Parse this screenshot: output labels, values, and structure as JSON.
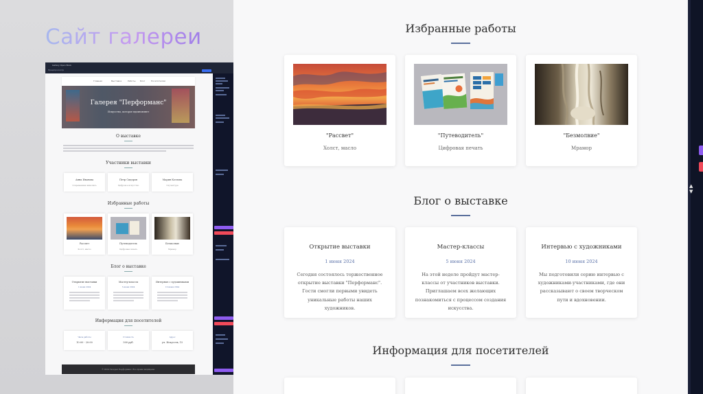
{
  "slide": {
    "title": "Сайт галереи"
  },
  "preview": {
    "window_title": "Gallery Open Book",
    "toolbar_label": "Предпросмотр",
    "nav_items": [
      "Главная",
      "Выставка",
      "Работы",
      "Блог",
      "Посетителям"
    ],
    "hero_title": "Галерея \"Перформанс\"",
    "hero_subtitle": "Искусство, которое вдохновляет",
    "about_title": "О выставке",
    "participants_title": "Участники выставки",
    "participants": [
      {
        "name": "Анна Иванова",
        "role": "Современная живопись"
      },
      {
        "name": "Петр Сидоров",
        "role": "Цифровое искусство"
      },
      {
        "name": "Мария Козлова",
        "role": "Скульптура"
      }
    ],
    "works_title": "Избранные работы",
    "works": [
      {
        "title": "Рассвет",
        "sub": "Холст, масло"
      },
      {
        "title": "Путеводитель",
        "sub": "Цифровая печать"
      },
      {
        "title": "Безмолвие",
        "sub": "Мрамор"
      }
    ],
    "blog_title": "Блог о выставке",
    "blog": [
      {
        "title": "Открытие выставки",
        "date": "1 июня 2024"
      },
      {
        "title": "Мастер-классы",
        "date": "5 июня 2024"
      },
      {
        "title": "Интервью с художниками",
        "date": "10 июня 2024"
      }
    ],
    "info_title": "Информация для посетителей",
    "info": [
      {
        "label": "Часы работы",
        "value": "10:00 - 20:00"
      },
      {
        "label": "Стоимость",
        "value": "500 руб."
      },
      {
        "label": "Адрес",
        "value": "ул. Искусств, 15"
      }
    ],
    "footer": "© 2024 Галерея Перформанс. Все права защищены."
  },
  "main": {
    "works_section": {
      "title": "Избранные работы",
      "cards": [
        {
          "title": "\"Рассвет\"",
          "subtitle": "Холст, масло",
          "image": "sunset-painting"
        },
        {
          "title": "\"Путеводитель\"",
          "subtitle": "Цифровая печать",
          "image": "guidebook-print"
        },
        {
          "title": "\"Безмолвие\"",
          "subtitle": "Мрамор",
          "image": "marble-sculpture"
        }
      ]
    },
    "blog_section": {
      "title": "Блог о выставке",
      "posts": [
        {
          "title": "Открытие выставки",
          "date": "1 июня 2024",
          "text": "Сегодня состоялось торжественное открытие выставки \"Перформанс\". Гости смогли первыми увидеть уникальные работы наших художников."
        },
        {
          "title": "Мастер-классы",
          "date": "5 июня 2024",
          "text": "На этой неделе пройдут мастер-классы от участников выставки. Приглашаем всех желающих познакомиться с процессом создания искусства."
        },
        {
          "title": "Интервью с художниками",
          "date": "10 июня 2024",
          "text": "Мы подготовили серию интервью с художниками-участниками, где они рассказывают о своем творческом пути и вдохновении."
        }
      ]
    },
    "info_section": {
      "title": "Информация для посетителей"
    }
  },
  "colors": {
    "accent": "#5a6f9c",
    "date": "#5b72a8",
    "slide_title_gradient": [
      "#a7b7ee",
      "#c59af0",
      "#9f7de8"
    ],
    "editor_bg": "#0f1426",
    "marker_purple": "#8e5cf0",
    "marker_red": "#f04a5a"
  }
}
